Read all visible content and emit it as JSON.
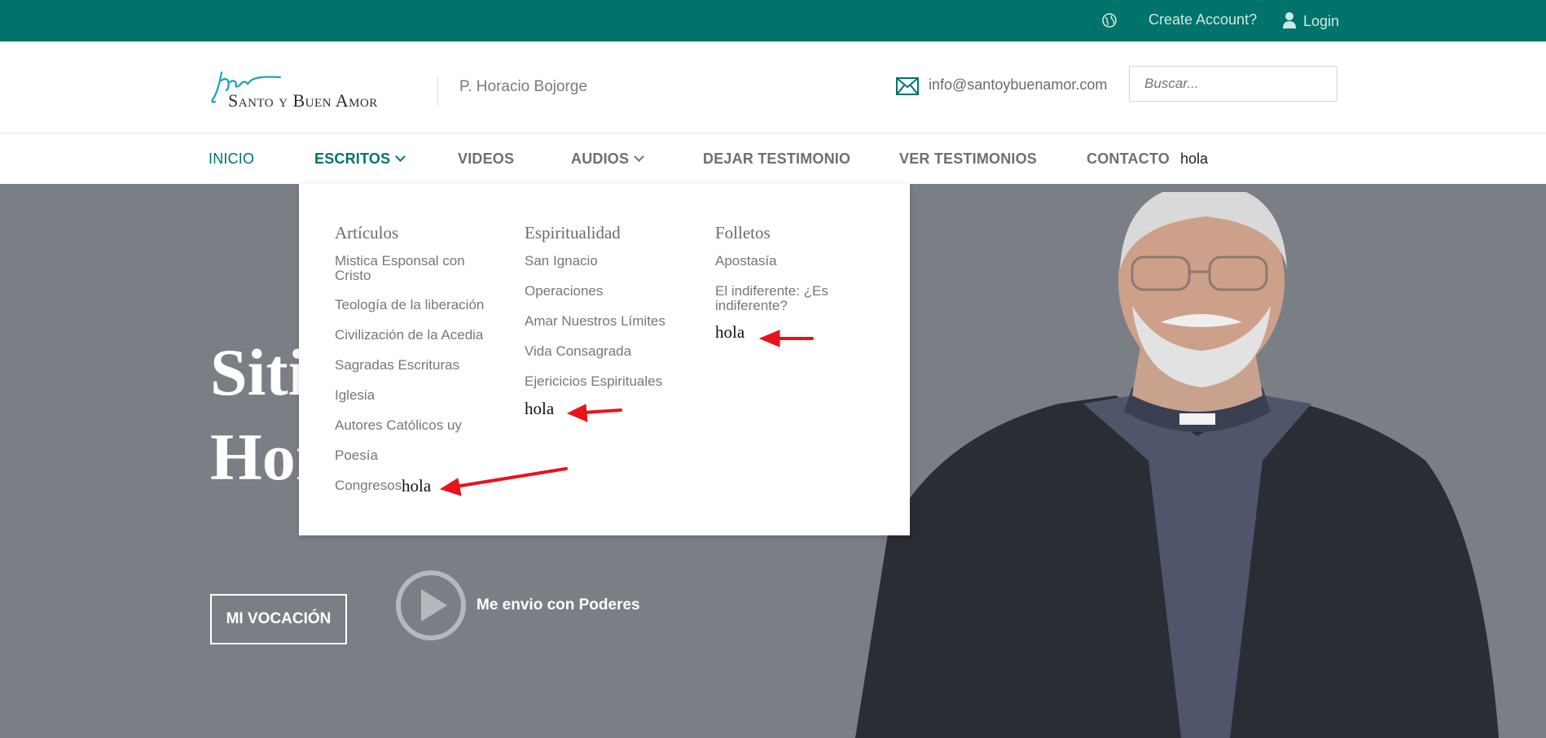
{
  "topbar": {
    "create_account": "Create Account?",
    "login": "Login"
  },
  "header": {
    "logo_text": "Santo y Buen Amor",
    "tagline": "P. Horacio Bojorge",
    "email": "info@santoybuenamor.com",
    "search_placeholder": "Buscar..."
  },
  "nav": {
    "items": [
      "INICIO",
      "ESCRITOS",
      "VIDEOS",
      "AUDIOS",
      "DEJAR TESTIMONIO",
      "VER TESTIMONIOS",
      "CONTACTO"
    ],
    "extra": "hola"
  },
  "dropdown": {
    "articulos": {
      "title": "Artículos",
      "items": [
        "Mistica Esponsal con Cristo",
        "Teología de la liberación",
        "Civilización de la Acedia",
        "Sagradas Escrituras",
        "Iglesia",
        "Autores Católicos uy",
        "Poesía",
        "Congresos"
      ],
      "extra": "hola"
    },
    "espiritualidad": {
      "title": "Espiritualidad",
      "items": [
        "San Ignacio",
        "Operaciones",
        "Amar Nuestros Límites",
        "Vida Consagrada",
        "Ejericicios Espirituales"
      ],
      "extra": "hola"
    },
    "folletos": {
      "title": "Folletos",
      "items": [
        "Apostasía",
        "El indiferente: ¿Es indiferente?"
      ],
      "extra": "hola"
    }
  },
  "hero": {
    "title_line1": "Sitio",
    "title_line2": "Horacio",
    "button": "MI VOCACIÓN",
    "video_label": "Me envio con Poderes"
  },
  "colors": {
    "brand": "#00736a",
    "hero_bg": "#7a7f86",
    "annotation": "#e8131b"
  }
}
